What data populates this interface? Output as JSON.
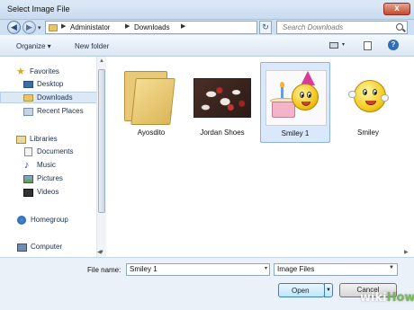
{
  "window": {
    "title": "Select Image File",
    "close_label": "x"
  },
  "address": {
    "crumbs": [
      "Administator",
      "Downloads"
    ],
    "search_placeholder": "Search Downloads"
  },
  "toolbar": {
    "organize": "Organize ▾",
    "new_folder": "New folder"
  },
  "nav": {
    "favorites": "Favorites",
    "desktop": "Desktop",
    "downloads": "Downloads",
    "recent": "Recent Places",
    "libraries": "Libraries",
    "documents": "Documents",
    "music": "Music",
    "pictures": "Pictures",
    "videos": "Videos",
    "homegroup": "Homegroup",
    "computer": "Computer"
  },
  "files": [
    {
      "label": "Ayosdito",
      "icon": "folder-icon"
    },
    {
      "label": "Jordan Shoes",
      "icon": "image-thumbnail"
    },
    {
      "label": "Smiley 1",
      "icon": "image-thumbnail",
      "selected": true
    },
    {
      "label": "Smiley",
      "icon": "image-thumbnail"
    }
  ],
  "bottom": {
    "file_name_label": "File name:",
    "file_name_value": "Smiley 1",
    "filter_value": "Image Files",
    "open_label": "Open",
    "cancel_label": "Cancel"
  },
  "watermark": {
    "wiki": "wiki",
    "how": "How"
  }
}
